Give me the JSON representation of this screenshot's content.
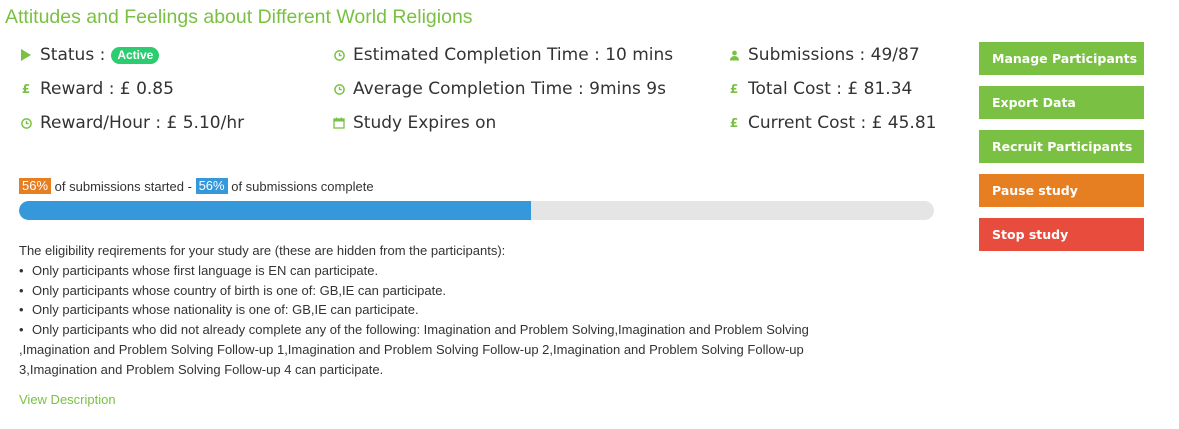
{
  "study": {
    "title": "Attitudes and Feelings about Different World Religions"
  },
  "stats": {
    "status_label": "Status :",
    "status_badge": "Active",
    "reward": "Reward : £ 0.85",
    "reward_per_hour": "Reward/Hour : £ 5.10/hr",
    "estimated_time": "Estimated Completion Time : 10 mins",
    "average_time": "Average Completion Time : 9mins 9s",
    "expires": "Study Expires on",
    "submissions": "Submissions : 49/87",
    "total_cost": "Total Cost : £ 81.34",
    "current_cost": "Current Cost : £ 45.81",
    "icons": {
      "status": "play-icon",
      "reward": "pound-icon",
      "reward_per_hour": "clock-icon",
      "estimated_time": "clock-icon",
      "average_time": "clock-icon",
      "expires": "calendar-icon",
      "submissions": "user-icon",
      "total_cost": "pound-icon",
      "current_cost": "pound-icon"
    }
  },
  "progress": {
    "started_pct": "56%",
    "started_text": "of submissions started -",
    "complete_pct": "56%",
    "complete_text": "of submissions complete",
    "fill_fraction": 0.56
  },
  "eligibility": {
    "intro": "The eligibility reqirements for your study are (these are hidden from the participants):",
    "items": [
      "Only participants whose first language is EN can participate.",
      "Only participants whose country of birth is one of: GB,IE can participate.",
      "Only participants whose nationality is one of: GB,IE can participate.",
      "Only participants who did not already complete any of the following: Imagination and Problem Solving,Imagination and Problem Solving"
    ],
    "continuation": [
      ",Imagination and Problem Solving Follow-up 1,Imagination and Problem Solving Follow-up 2,Imagination and Problem Solving Follow-up",
      "3,Imagination and Problem Solving Follow-up 4 can participate."
    ]
  },
  "links": {
    "view_description": "View Description"
  },
  "actions": {
    "manage": "Manage Participants",
    "export": "Export Data",
    "recruit": "Recruit Participants",
    "pause": "Pause study",
    "stop": "Stop study"
  },
  "colors": {
    "brand_green": "#7ac143",
    "active_badge": "#2ecc71",
    "progress_blue": "#3498db",
    "progress_orange": "#e67e22",
    "danger_red": "#e74c3c"
  }
}
